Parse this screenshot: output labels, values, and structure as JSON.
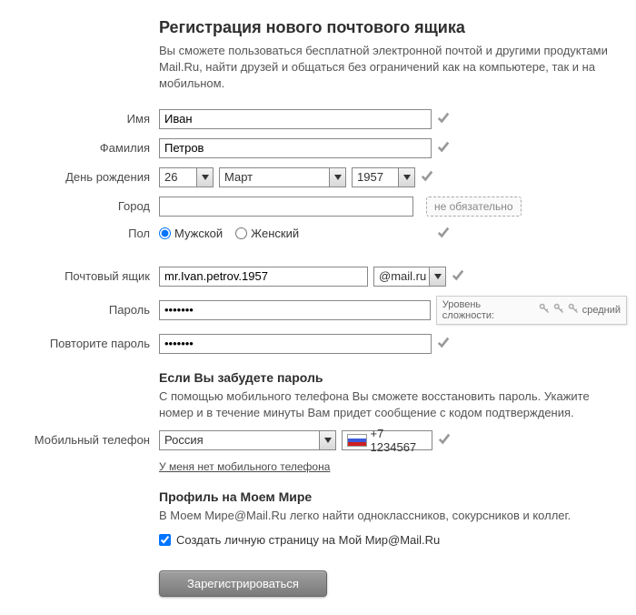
{
  "header": {
    "title": "Регистрация нового почтового ящика",
    "subtitle": "Вы сможете пользоваться бесплатной электронной почтой и другими продуктами Mail.Ru, найти друзей и общаться без ограничений как на компьютере, так и на мобильном."
  },
  "labels": {
    "first_name": "Имя",
    "last_name": "Фамилия",
    "birthday": "День рождения",
    "city": "Город",
    "gender": "Пол",
    "mailbox": "Почтовый ящик",
    "password": "Пароль",
    "password_confirm": "Повторите пароль",
    "mobile": "Мобильный телефон"
  },
  "values": {
    "first_name": "Иван",
    "last_name": "Петров",
    "day": "26",
    "month": "Март",
    "year": "1957",
    "city": "",
    "mailbox": "mr.Ivan.petrov.1957",
    "password": "•••••••",
    "password_confirm": "•••••••",
    "country": "Россия",
    "phone": "+7 1234567"
  },
  "domain_select": {
    "value": "@mail.ru"
  },
  "gender": {
    "male": "Мужской",
    "female": "Женский",
    "selected": "male"
  },
  "hints": {
    "city_optional": "не обязательно"
  },
  "password_strength": {
    "label": "Уровень сложности:",
    "value": "средний"
  },
  "recovery": {
    "title": "Если Вы забудете пароль",
    "text": "С помощью мобильного телефона Вы сможете восстановить пароль. Укажите номер и в течение минуты Вам придет сообщение с кодом подтверждения.",
    "no_phone": "У меня нет мобильного телефона"
  },
  "profile": {
    "title": "Профиль на Моем Мире",
    "text": "В Моем Мире@Mail.Ru легко найти одноклассников, сокурсников и коллег.",
    "checkbox_label": "Создать личную страницу на Мой Мир@Mail.Ru"
  },
  "submit": "Зарегистрироваться"
}
